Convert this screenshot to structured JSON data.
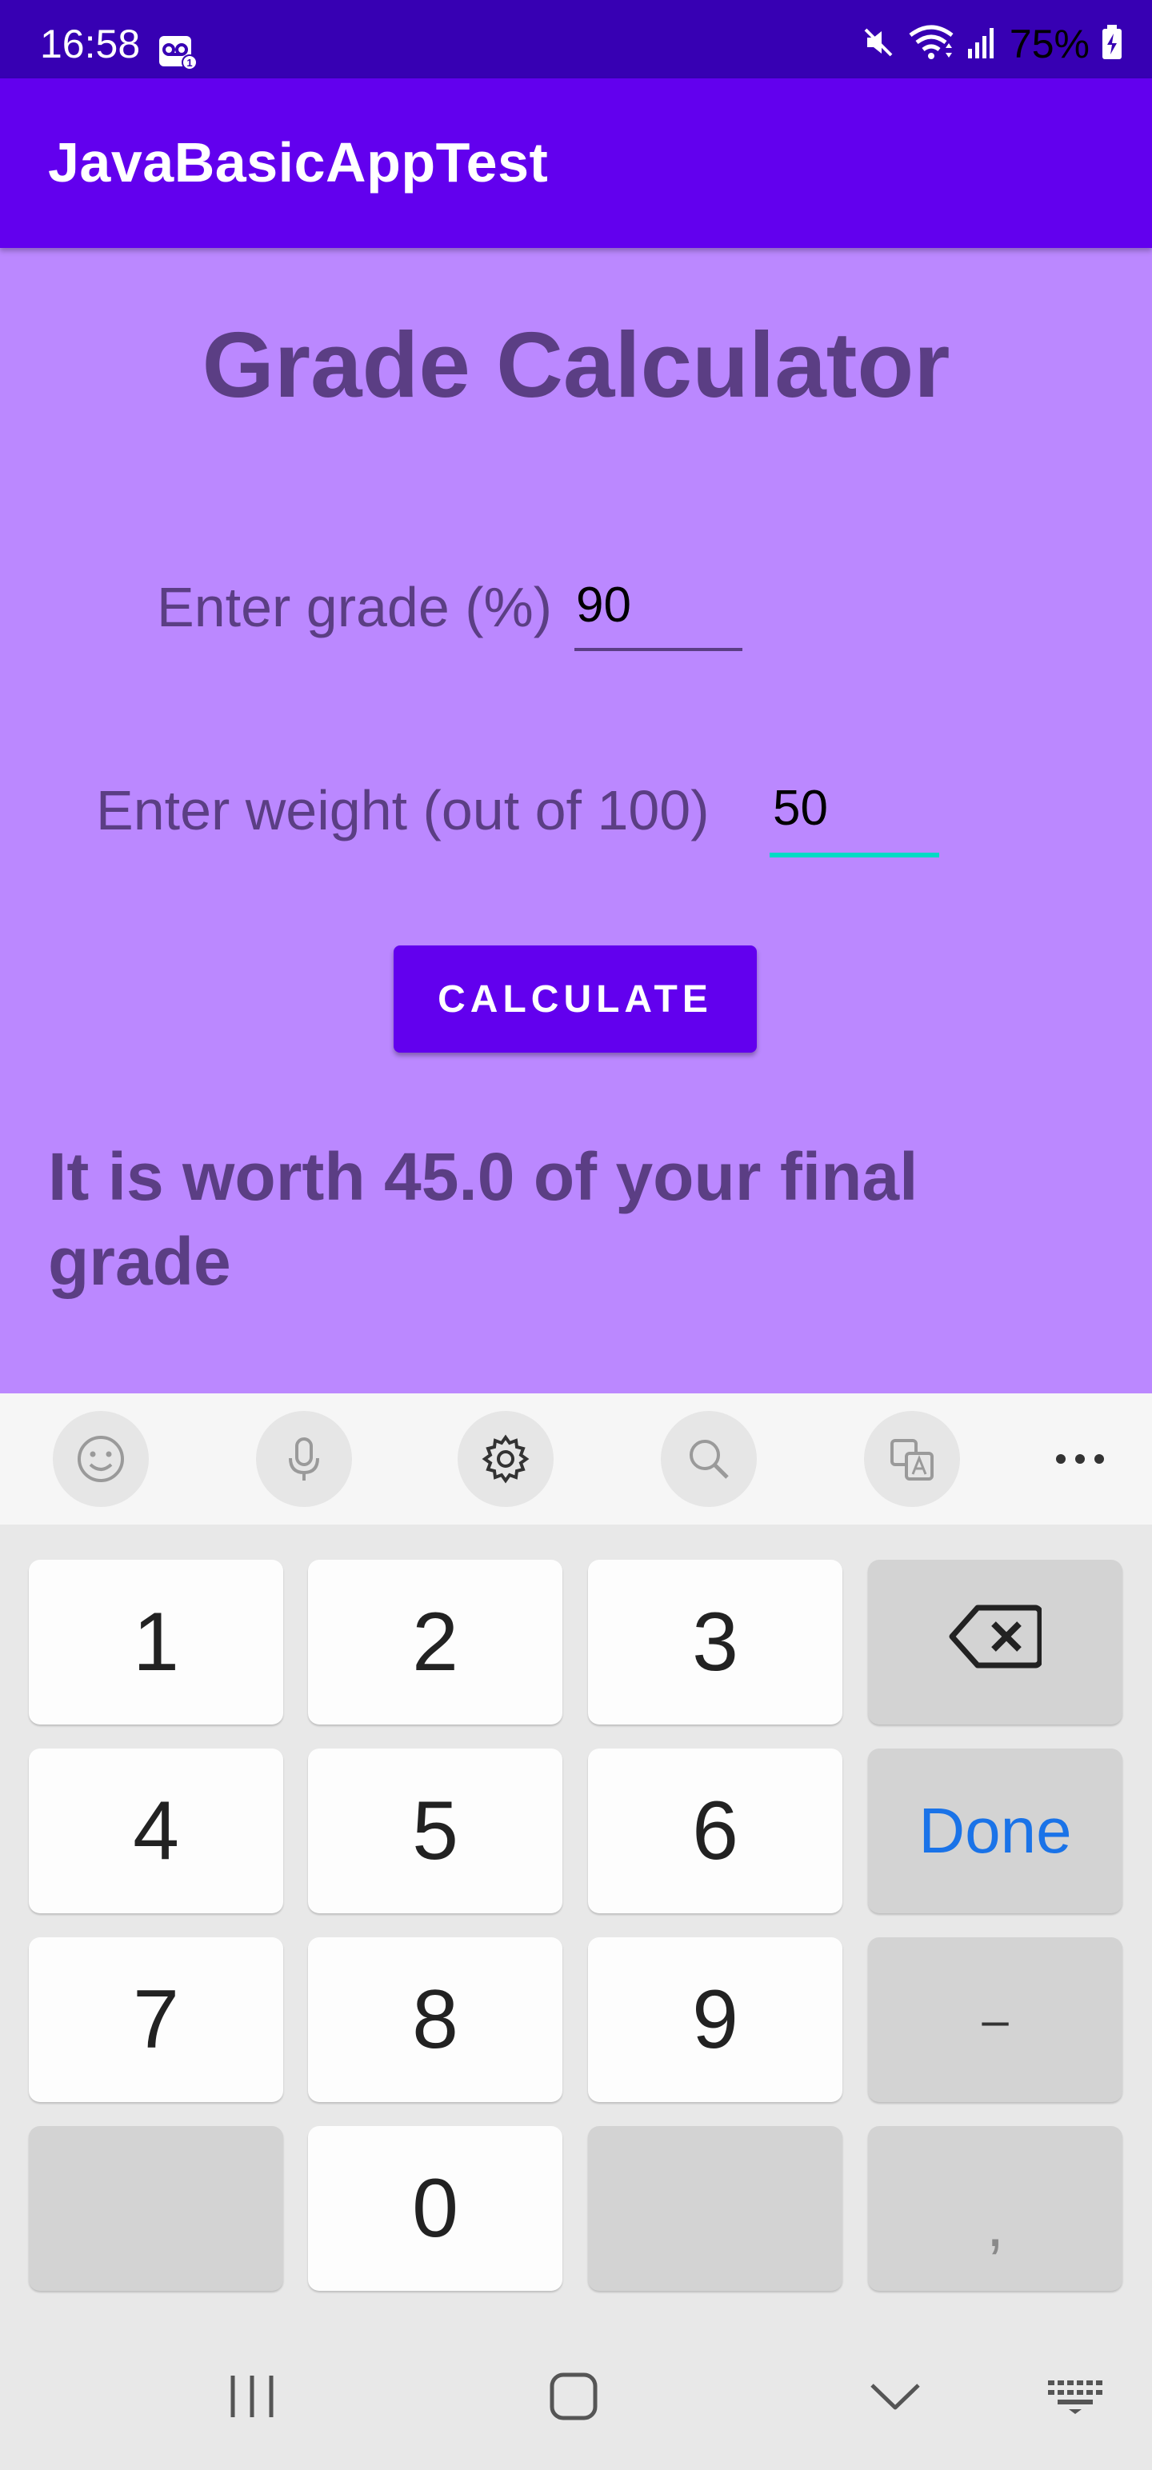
{
  "status_bar": {
    "time": "16:58",
    "battery": "75%",
    "icons": [
      "voicemail-icon",
      "mute-icon",
      "wifi-icon",
      "signal-icon",
      "battery-icon"
    ]
  },
  "app_bar": {
    "title": "JavaBasicAppTest"
  },
  "screen": {
    "title": "Grade Calculator",
    "grade_label": "Enter grade (%)",
    "grade_value": "90",
    "weight_label": "Enter weight (out of 100)",
    "weight_value": "50",
    "calculate_label": "CALCULATE",
    "result_text": "It is worth 45.0 of your final grade"
  },
  "keyboard": {
    "toolbar": [
      "emoji-icon",
      "microphone-icon",
      "settings-icon",
      "search-icon",
      "translate-icon",
      "more-icon"
    ],
    "keys": {
      "k1": "1",
      "k2": "2",
      "k3": "3",
      "k4": "4",
      "k5": "5",
      "k6": "6",
      "k7": "7",
      "k8": "8",
      "k9": "9",
      "k0": "0",
      "done": "Done",
      "minus": "–",
      "comma": ","
    }
  },
  "colors": {
    "status_bar": "#3700b3",
    "app_bar": "#6200ee",
    "background": "#bb88ff",
    "text": "#5b3e84",
    "focus_underline": "#03dac5",
    "done_key": "#1a73e8"
  }
}
